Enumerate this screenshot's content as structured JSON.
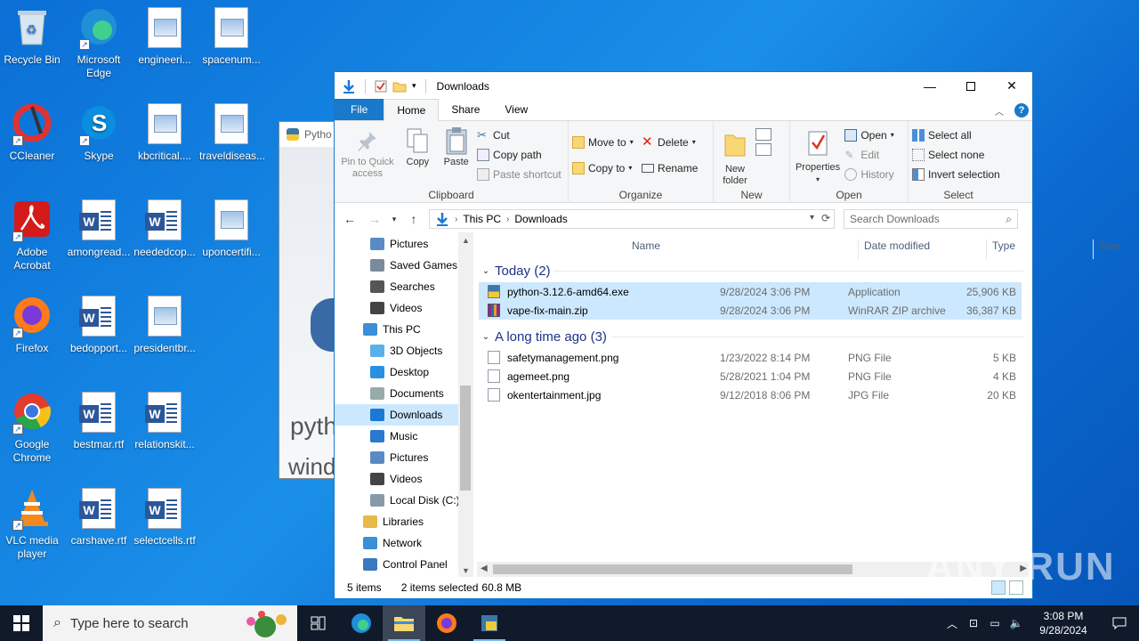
{
  "desktop": {
    "icons": [
      {
        "label": "Recycle Bin"
      },
      {
        "label": "Microsoft Edge"
      },
      {
        "label": "engineeri..."
      },
      {
        "label": "spacenum..."
      },
      {
        "label": "CCleaner"
      },
      {
        "label": "Skype"
      },
      {
        "label": "kbcritical...."
      },
      {
        "label": "traveldiseas..."
      },
      {
        "label": "Adobe Acrobat"
      },
      {
        "label": "amongread..."
      },
      {
        "label": "neededcop..."
      },
      {
        "label": "uponcertifi..."
      },
      {
        "label": "Firefox"
      },
      {
        "label": "bedopport..."
      },
      {
        "label": "presidentbr..."
      },
      {
        "label": "Google Chrome"
      },
      {
        "label": "bestmar.rtf"
      },
      {
        "label": "relationskit..."
      },
      {
        "label": "VLC media player"
      },
      {
        "label": "carshave.rtf"
      },
      {
        "label": "selectcells.rtf"
      }
    ]
  },
  "bg_window": {
    "title": "Pytho",
    "text1": "pyth",
    "text2": "wind"
  },
  "explorer": {
    "title": "Downloads",
    "tabs": {
      "file": "File",
      "home": "Home",
      "share": "Share",
      "view": "View"
    },
    "ribbon": {
      "clipboard": {
        "pin": "Pin to Quick access",
        "copy": "Copy",
        "paste": "Paste",
        "cut": "Cut",
        "copy_path": "Copy path",
        "paste_shortcut": "Paste shortcut",
        "group": "Clipboard"
      },
      "organize": {
        "move_to": "Move to",
        "copy_to": "Copy to",
        "delete": "Delete",
        "rename": "Rename",
        "group": "Organize"
      },
      "new": {
        "new_folder": "New folder",
        "group": "New"
      },
      "open": {
        "properties": "Properties",
        "open": "Open",
        "edit": "Edit",
        "history": "History",
        "group": "Open"
      },
      "select": {
        "select_all": "Select all",
        "select_none": "Select none",
        "invert": "Invert selection",
        "group": "Select"
      }
    },
    "address": {
      "this_pc": "This PC",
      "downloads": "Downloads"
    },
    "search": {
      "placeholder": "Search Downloads"
    },
    "nav": [
      {
        "label": "Pictures",
        "indent": 1,
        "icon": "pictures"
      },
      {
        "label": "Saved Games",
        "indent": 1,
        "icon": "games"
      },
      {
        "label": "Searches",
        "indent": 1,
        "icon": "search"
      },
      {
        "label": "Videos",
        "indent": 1,
        "icon": "videos"
      },
      {
        "label": "This PC",
        "indent": 0,
        "icon": "pc"
      },
      {
        "label": "3D Objects",
        "indent": 1,
        "icon": "3d"
      },
      {
        "label": "Desktop",
        "indent": 1,
        "icon": "desktop"
      },
      {
        "label": "Documents",
        "indent": 1,
        "icon": "documents"
      },
      {
        "label": "Downloads",
        "indent": 1,
        "icon": "downloads",
        "selected": true
      },
      {
        "label": "Music",
        "indent": 1,
        "icon": "music"
      },
      {
        "label": "Pictures",
        "indent": 1,
        "icon": "pictures"
      },
      {
        "label": "Videos",
        "indent": 1,
        "icon": "videos"
      },
      {
        "label": "Local Disk (C:)",
        "indent": 1,
        "icon": "disk"
      },
      {
        "label": "Libraries",
        "indent": 0,
        "icon": "libraries"
      },
      {
        "label": "Network",
        "indent": 0,
        "icon": "network"
      },
      {
        "label": "Control Panel",
        "indent": 0,
        "icon": "control"
      }
    ],
    "columns": {
      "name": "Name",
      "date": "Date modified",
      "type": "Type",
      "size": "Size"
    },
    "groups": [
      {
        "label": "Today (2)",
        "files": [
          {
            "name": "python-3.12.6-amd64.exe",
            "date": "9/28/2024 3:06 PM",
            "type": "Application",
            "size": "25,906 KB",
            "selected": true,
            "icon": "exe"
          },
          {
            "name": "vape-fix-main.zip",
            "date": "9/28/2024 3:06 PM",
            "type": "WinRAR ZIP archive",
            "size": "36,387 KB",
            "selected": true,
            "icon": "zip"
          }
        ]
      },
      {
        "label": "A long time ago (3)",
        "files": [
          {
            "name": "safetymanagement.png",
            "date": "1/23/2022 8:14 PM",
            "type": "PNG File",
            "size": "5 KB",
            "selected": false,
            "icon": "png"
          },
          {
            "name": "agemeet.png",
            "date": "5/28/2021 1:04 PM",
            "type": "PNG File",
            "size": "4 KB",
            "selected": false,
            "icon": "png"
          },
          {
            "name": "okentertainment.jpg",
            "date": "9/12/2018 8:06 PM",
            "type": "JPG File",
            "size": "20 KB",
            "selected": false,
            "icon": "jpg"
          }
        ]
      }
    ],
    "status": {
      "items": "5 items",
      "selected": "2 items selected",
      "size": "60.8 MB"
    }
  },
  "watermark": "ANY RUN",
  "taskbar": {
    "search_placeholder": "Type here to search",
    "time": "3:08 PM",
    "date": "9/28/2024"
  }
}
